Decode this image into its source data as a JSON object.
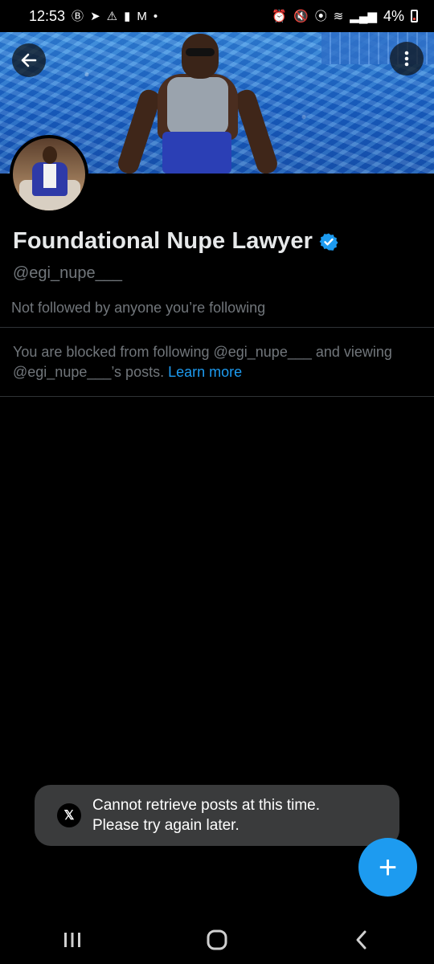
{
  "status_bar": {
    "time": "12:53",
    "battery_text": "4%",
    "left_icons": [
      "b-circle-icon",
      "telegram-icon",
      "warning-icon",
      "battery-alert-icon",
      "gmail-icon",
      "dot-icon"
    ],
    "right_icons": [
      "alarm-icon",
      "mute-icon",
      "location-icon",
      "wifi-icon",
      "volte-icon",
      "signal-icon",
      "battery-icon"
    ],
    "battery_level": 0.04
  },
  "profile": {
    "display_name": "Foundational Nupe Lawyer",
    "handle": "@egi_nupe___",
    "verified": true,
    "followers_note": "Not followed by anyone you’re following",
    "blocked_message": "You are blocked from following @egi_nupe___ and viewing @egi_nupe___’s posts.",
    "learn_more": "Learn more"
  },
  "toast": {
    "line1": "Cannot retrieve posts at this time.",
    "line2": "Please try again later.",
    "logo": "𝕏"
  },
  "fab": {
    "label": "+"
  },
  "colors": {
    "background": "#000000",
    "accent": "#1d9bf0",
    "muted_text": "#71767b",
    "toast_bg": "#3a3b3c"
  }
}
